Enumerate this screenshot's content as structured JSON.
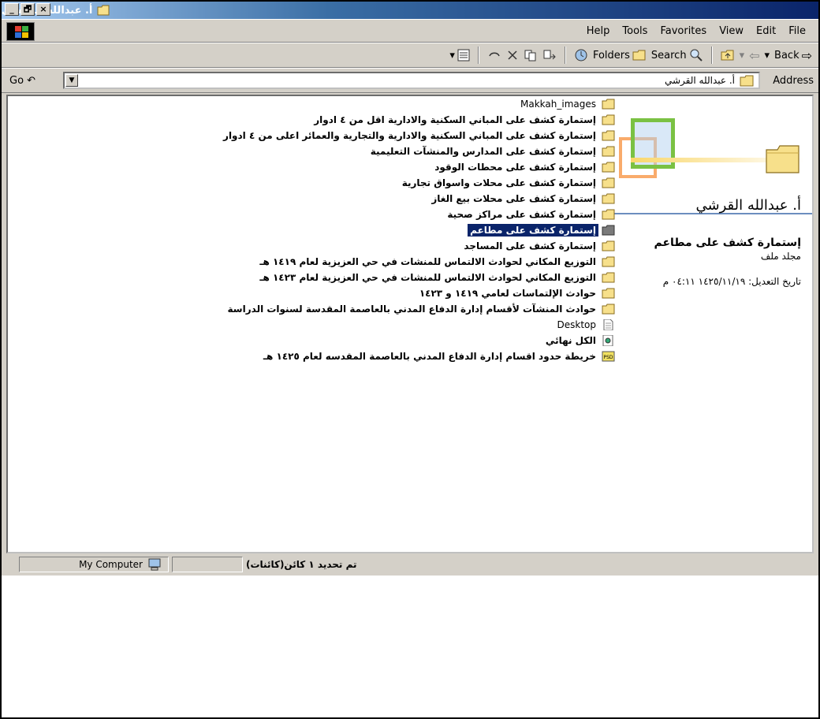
{
  "window": {
    "title": "أ. عبدالله القرشي",
    "controls": [
      "_",
      "🗗",
      "×"
    ]
  },
  "menubar": {
    "items": [
      {
        "label": "Help"
      },
      {
        "label": "Tools"
      },
      {
        "label": "Favorites"
      },
      {
        "label": "View"
      },
      {
        "label": "Edit"
      },
      {
        "label": "File"
      }
    ]
  },
  "toolbar": {
    "back_label": "Back",
    "search_label": "Search",
    "folders_label": "Folders"
  },
  "addressbar": {
    "label": "Address",
    "value": "أ. عبدالله القرشي",
    "go_label": "Go"
  },
  "info_panel": {
    "folder_title": "أ. عبدالله القرشي",
    "selected_name": "إستمارة كشف على مطاعم",
    "selected_type": "مجلد ملف",
    "modified": "تاريخ التعديل: ١٤٢٥/١١/١٩ ٠٤:١١ م"
  },
  "files": [
    {
      "name": "Makkah_images",
      "icon": "folder-icon",
      "ltr": true
    },
    {
      "name": "إستمارة كشف على المباني السكنية والادارية  اقل من ٤ ادوار",
      "icon": "folder-icon"
    },
    {
      "name": "إستمارة كشف على المباني السكنية والادارية والتجارية والعمائر اعلى من ٤ ادوار",
      "icon": "folder-icon"
    },
    {
      "name": "إستمارة كشف على المدارس والمنشآت التعليمية",
      "icon": "folder-icon"
    },
    {
      "name": "إستمارة كشف على محطات الوقود",
      "icon": "folder-icon"
    },
    {
      "name": "إستمارة كشف على محلات  واسواق تجارية",
      "icon": "folder-icon"
    },
    {
      "name": "إستمارة كشف على محلات بيع  الغاز",
      "icon": "folder-icon"
    },
    {
      "name": "إستمارة كشف على مراكز صحية",
      "icon": "folder-icon"
    },
    {
      "name": "إستمارة كشف على مطاعم",
      "icon": "folder-open-icon",
      "selected": true
    },
    {
      "name": "إستمارة كشف على المساجد",
      "icon": "folder-icon"
    },
    {
      "name": "التوزيع المكاني لحوادث الالتماس للمنشات في حي العزيزية لعام ١٤١٩ هـ",
      "icon": "folder-icon"
    },
    {
      "name": "التوزيع المكاني لحوادث الالتماس للمنشات في حي العزيزية لعام ١٤٢٣ هـ",
      "icon": "folder-icon"
    },
    {
      "name": "حوادث  الإلتماسات لعامي ١٤١٩  و  ١٤٢٣",
      "icon": "folder-icon"
    },
    {
      "name": "حوادث المنشآت لأقسام إدارة الدفاع المدني بالعاصمة المقدسة لسنوات الدراسة",
      "icon": "folder-icon"
    },
    {
      "name": "Desktop",
      "icon": "file-icon",
      "ltr": true
    },
    {
      "name": "الكل نهائي",
      "icon": "image-file-icon"
    },
    {
      "name": "خريطة حدود اقسام إدارة الدفاع المدني بالعاصمة المقدسه لعام ١٤٢٥ هـ",
      "icon": "psd-file-icon"
    }
  ],
  "statusbar": {
    "zone": "My Computer",
    "summary": "تم تحديد ١ كائن(كائنات)"
  },
  "colors": {
    "title_active": "#0a246a",
    "selection": "#0a246a",
    "chrome": "#d4d0c8",
    "folder": "#f7e08b"
  }
}
